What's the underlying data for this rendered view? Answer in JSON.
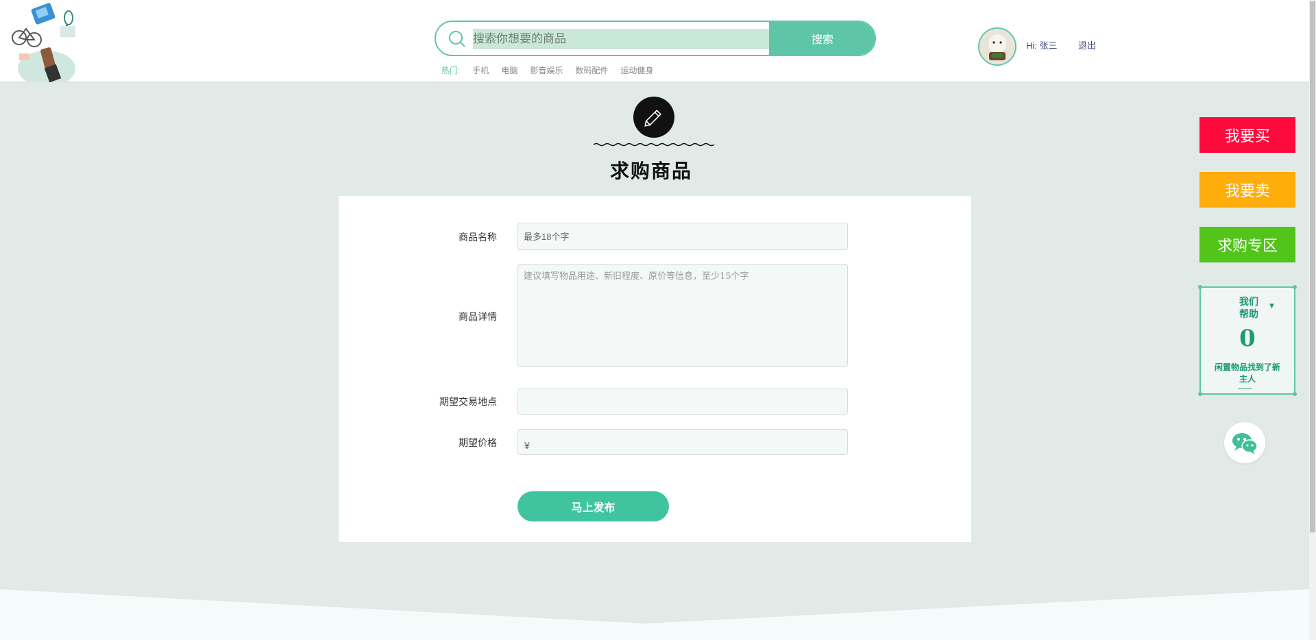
{
  "header": {
    "search": {
      "placeholder": "搜索你想要的商品",
      "button_label": "搜索"
    },
    "hot": {
      "label": "热门:",
      "links": [
        "手机",
        "电脑",
        "影音娱乐",
        "数码配件",
        "运动健身"
      ]
    },
    "user": {
      "greeting": "Hi: 张三",
      "logout_label": "退出"
    }
  },
  "page": {
    "title": "求购商品"
  },
  "form": {
    "name": {
      "label": "商品名称",
      "placeholder": "最多18个字"
    },
    "detail": {
      "label": "商品详情",
      "placeholder": "建议填写物品用途、新旧程度、原价等信息，至少15个字"
    },
    "location": {
      "label": "期望交易地点",
      "value": ""
    },
    "price": {
      "label": "期望价格",
      "symbol": "¥"
    },
    "submit_label": "马上发布"
  },
  "side": {
    "buy_label": "我要买",
    "sell_label": "我要卖",
    "request_label": "求购专区",
    "help": {
      "title": "我们帮助",
      "count": "0",
      "subtitle": "闲置物品找到了新主人"
    }
  },
  "colors": {
    "accent": "#5ec6a6",
    "buy": "#ff0a3c",
    "sell": "#ffad0a",
    "request": "#52c41a"
  },
  "icons": {
    "search": "search-icon",
    "pencil": "pencil-icon",
    "wechat": "wechat-icon",
    "logo": "logo-illustration"
  }
}
